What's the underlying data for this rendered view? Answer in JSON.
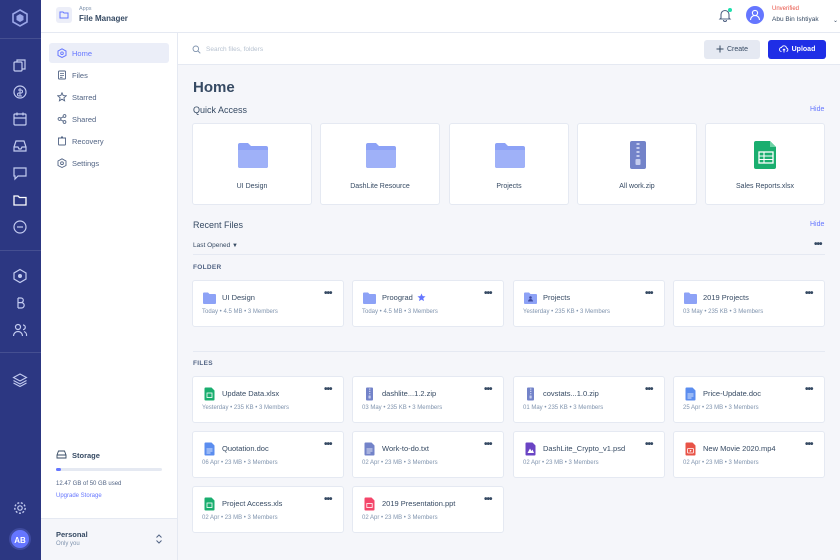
{
  "app": {
    "subtitle": "Apps",
    "title": "File Manager"
  },
  "user": {
    "status": "Unverified",
    "name": "Abu Bin Ishtiyak",
    "initials": "AB"
  },
  "rail_icons": [
    "logo-icon",
    "dashboard-icon",
    "coin-icon",
    "calendar-icon",
    "inbox-icon",
    "chat-icon",
    "folder-icon",
    "message-icon",
    "crypto-icon",
    "bitcoin-icon",
    "users-icon",
    "layers-icon",
    "settings-icon"
  ],
  "sidebar": {
    "items": [
      {
        "label": "Home",
        "icon": "home-icon",
        "active": true
      },
      {
        "label": "Files",
        "icon": "files-icon"
      },
      {
        "label": "Starred",
        "icon": "star-icon"
      },
      {
        "label": "Shared",
        "icon": "share-icon"
      },
      {
        "label": "Recovery",
        "icon": "recovery-icon"
      },
      {
        "label": "Settings",
        "icon": "settings-icon"
      }
    ],
    "storage": {
      "title": "Storage",
      "used_text": "12.47 GB of 50 GB used",
      "used_fraction": 0.05,
      "upgrade": "Upgrade Storage"
    },
    "personal": {
      "title": "Personal",
      "subtitle": "Only you"
    }
  },
  "search": {
    "placeholder": "Search files, folders"
  },
  "actions": {
    "create": "Create",
    "upload": "Upload"
  },
  "main": {
    "title": "Home",
    "quick_access": {
      "title": "Quick Access",
      "hide": "Hide",
      "items": [
        {
          "label": "UI Design",
          "icon": "folder-icon"
        },
        {
          "label": "DashLite Resource",
          "icon": "folder-icon"
        },
        {
          "label": "Projects",
          "icon": "folder-icon"
        },
        {
          "label": "All work.zip",
          "icon": "zip-icon"
        },
        {
          "label": "Sales Reports.xlsx",
          "icon": "sheet-icon"
        }
      ]
    },
    "recent": {
      "title": "Recent Files",
      "hide": "Hide",
      "sort": "Last Opened",
      "folder_label": "FOLDER",
      "files_label": "FILES",
      "folders": [
        {
          "name": "UI Design",
          "meta": "Today • 4.5 MB • 3 Members",
          "icon": "folder-icon"
        },
        {
          "name": "Proograd",
          "meta": "Today • 4.5 MB • 3 Members",
          "icon": "folder-icon",
          "starred": true
        },
        {
          "name": "Projects",
          "meta": "Yesterday • 235 KB • 3 Members",
          "icon": "shared-folder-icon"
        },
        {
          "name": "2019 Projects",
          "meta": "03 May • 235 KB • 3 Members",
          "icon": "folder-icon"
        }
      ],
      "files": [
        {
          "name": "Update Data.xlsx",
          "meta": "Yesterday • 235 KB • 3 Members",
          "icon": "sheet-icon"
        },
        {
          "name": "dashlite...1.2.zip",
          "meta": "03 May • 235 KB • 3 Members",
          "icon": "zip-icon"
        },
        {
          "name": "covstats...1.0.zip",
          "meta": "01 May • 235 KB • 3 Members",
          "icon": "zip-icon"
        },
        {
          "name": "Price-Update.doc",
          "meta": "25 Apr • 23 MB • 3 Members",
          "icon": "doc-icon"
        },
        {
          "name": "Quotation.doc",
          "meta": "06 Apr • 23 MB • 3 Members",
          "icon": "doc-icon"
        },
        {
          "name": "Work-to-do.txt",
          "meta": "02 Apr • 23 MB • 3 Members",
          "icon": "text-file-icon"
        },
        {
          "name": "DashLite_Crypto_v1.psd",
          "meta": "02 Apr • 23 MB • 3 Members",
          "icon": "psd-icon"
        },
        {
          "name": "New Movie 2020.mp4",
          "meta": "02 Apr • 23 MB • 3 Members",
          "icon": "video-icon"
        },
        {
          "name": "Project Access.xls",
          "meta": "02 Apr • 23 MB • 3 Members",
          "icon": "sheet-icon"
        },
        {
          "name": "2019 Presentation.ppt",
          "meta": "02 Apr • 23 MB • 3 Members",
          "icon": "ppt-icon"
        }
      ]
    }
  },
  "colors": {
    "rail": "#2c3782",
    "accent": "#6576ff",
    "primary_button": "#1f2ee6",
    "folder": "#8da2f6",
    "zip": "#6a7bc4",
    "sheet": "#1aae6f",
    "doc": "#5b8def",
    "psd": "#6a44c4",
    "video": "#e85347",
    "ppt": "#f4466a"
  }
}
